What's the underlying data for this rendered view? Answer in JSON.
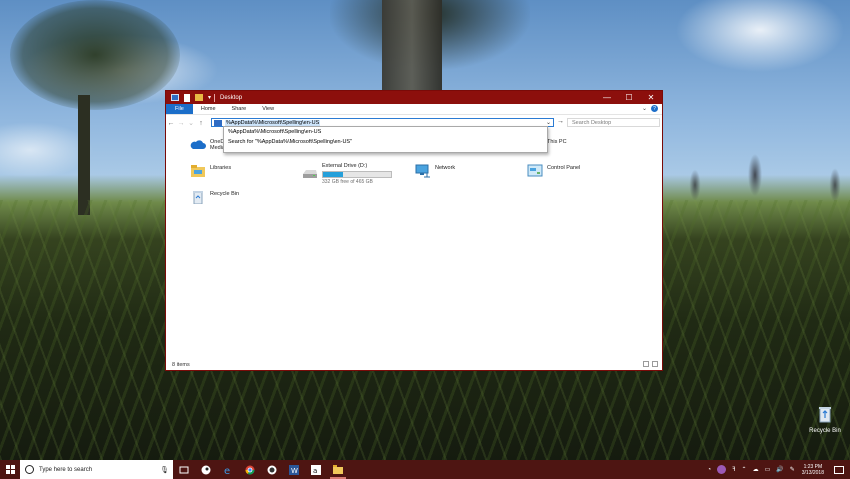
{
  "window": {
    "title": "Desktop",
    "controls": {
      "minimize": "—",
      "maximize": "☐",
      "close": "✕"
    }
  },
  "ribbon": {
    "tabs": [
      "File",
      "Home",
      "Share",
      "View"
    ],
    "help": "?"
  },
  "navigation": {
    "back": "←",
    "forward": "→",
    "recent": "⌄",
    "up": "↑",
    "address_value": "%AppData%\\Microsoft\\Spelling\\en-US",
    "dropdown": "⌄",
    "refresh": "↻",
    "go": "→",
    "search_placeholder": "Search Desktop"
  },
  "address_suggestions": [
    "%AppData%\\Microsoft\\Spelling\\en-US",
    "Search for \"%AppData%\\Microsoft\\Spelling\\en-US\""
  ],
  "items": [
    {
      "label": "OneDrive",
      "sublabel": "Media",
      "icon": "onedrive-icon"
    },
    {
      "label": "This PC",
      "icon": "this-pc-icon"
    },
    {
      "label": "Libraries",
      "icon": "libraries-icon"
    },
    {
      "label": "External Drive (D:)",
      "free": "332 GB free of 465 GB",
      "used_fraction": 0.29,
      "icon": "drive-icon"
    },
    {
      "label": "Network",
      "icon": "network-icon"
    },
    {
      "label": "Control Panel",
      "icon": "control-panel-icon"
    },
    {
      "label": "Recycle Bin",
      "icon": "recycle-bin-icon"
    }
  ],
  "status": {
    "count": "8 items"
  },
  "desktop": {
    "icon_label": "Recycle Bin"
  },
  "taskbar": {
    "search_placeholder": "Type here to search",
    "clock_time": "1:23 PM",
    "clock_date": "3/13/2018",
    "apps": [
      "task-view-icon",
      "steam-icon",
      "edge-icon",
      "chrome-icon",
      "obs-icon",
      "word-icon",
      "amazon-icon",
      "file-explorer-icon"
    ]
  },
  "colors": {
    "titlebar": "#8c0f0c",
    "taskbar": "#4e1512",
    "accent": "#1c6ec9",
    "drive_fill": "#26a0da"
  }
}
